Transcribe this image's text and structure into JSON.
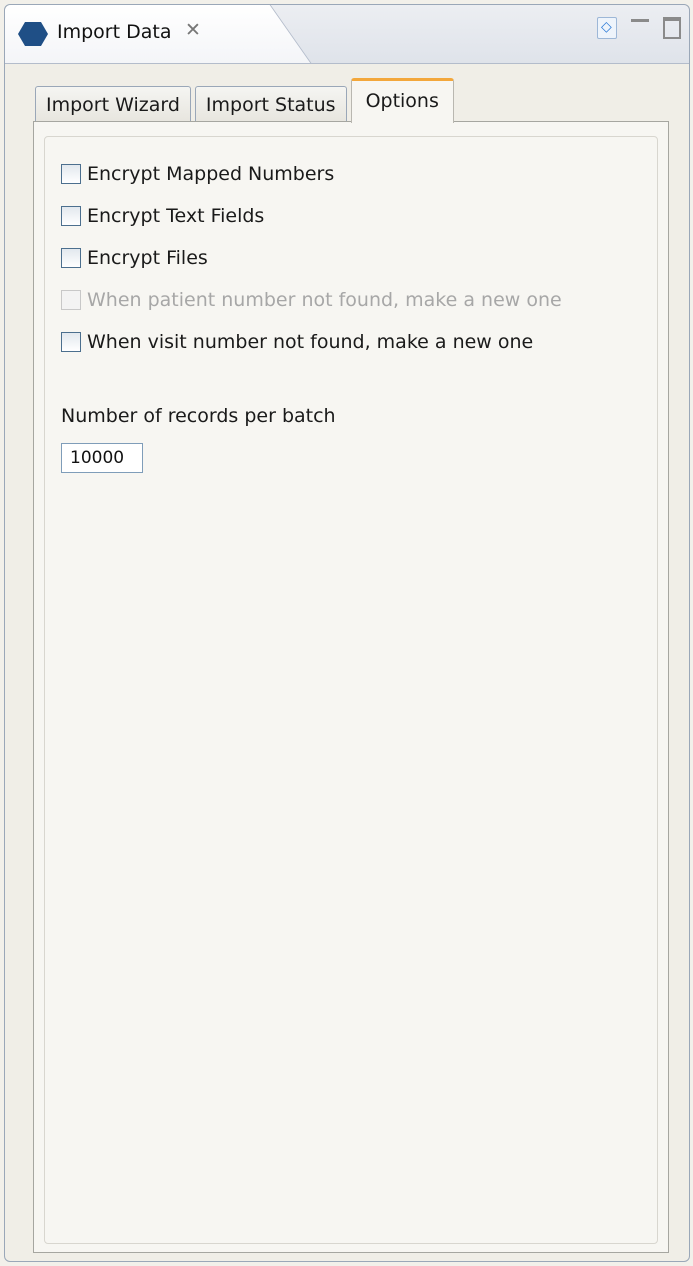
{
  "view": {
    "title": "Import Data",
    "close_symbol": "✕",
    "icons": [
      "import-data-icon",
      "view-menu-icon",
      "minimize-icon",
      "maximize-icon"
    ]
  },
  "tabs": [
    {
      "label": "Import Wizard",
      "active": false
    },
    {
      "label": "Import Status",
      "active": false
    },
    {
      "label": "Options",
      "active": true
    }
  ],
  "options": [
    {
      "label": "Encrypt Mapped Numbers",
      "checked": false,
      "enabled": true
    },
    {
      "label": "Encrypt Text Fields",
      "checked": false,
      "enabled": true
    },
    {
      "label": "Encrypt Files",
      "checked": false,
      "enabled": true
    },
    {
      "label": "When patient number not found, make a new one",
      "checked": false,
      "enabled": false
    },
    {
      "label": "When visit number not found, make a new one",
      "checked": false,
      "enabled": true
    }
  ],
  "batch": {
    "label": "Number of records per batch",
    "value": "10000"
  },
  "colors": {
    "active_tab_accent": "#f3a73b",
    "checkbox_border": "#4c6f8e",
    "disabled_text": "#a7a7a7"
  }
}
